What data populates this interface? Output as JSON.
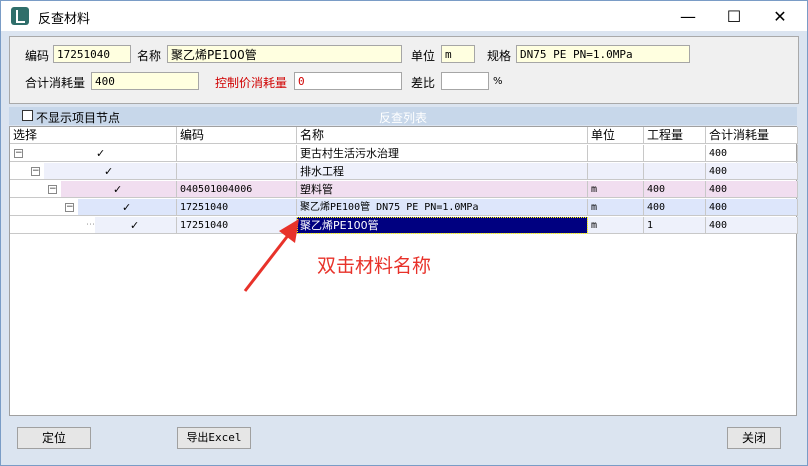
{
  "window": {
    "title": "反查材料"
  },
  "form": {
    "code_label": "编码",
    "code_value": "17251040",
    "name_label": "名称",
    "name_value": "聚乙烯PE100管",
    "unit_label": "单位",
    "unit_value": "m",
    "spec_label": "规格",
    "spec_value": "DN75 PE PN=1.0MPa",
    "total_label": "合计消耗量",
    "total_value": "400",
    "control_label": "控制价消耗量",
    "control_value": "0",
    "diff_label": "差比",
    "diff_value": "",
    "percent": "%"
  },
  "list": {
    "caption": "反查列表",
    "hide_nodes_label": "不显示项目节点",
    "headers": {
      "select": "选择",
      "code": "编码",
      "name": "名称",
      "unit": "单位",
      "qty": "工程量",
      "total": "合计消耗量"
    },
    "rows": [
      {
        "code": "",
        "name": "更古村生活污水治理",
        "unit": "",
        "qty": "",
        "total": "400"
      },
      {
        "code": "",
        "name": "排水工程",
        "unit": "",
        "qty": "",
        "total": "400"
      },
      {
        "code": "040501004006",
        "name": "塑料管",
        "unit": "m",
        "qty": "400",
        "total": "400"
      },
      {
        "code": "17251040",
        "name": "聚乙烯PE100管 DN75 PE PN=1.0MPa",
        "unit": "m",
        "qty": "400",
        "total": "400"
      },
      {
        "code": "17251040",
        "name": "聚乙烯PE100管",
        "unit": "m",
        "qty": "1",
        "total": "400"
      }
    ]
  },
  "buttons": {
    "locate": "定位",
    "export": "导出Excel",
    "close": "关闭"
  },
  "annotation": "双击材料名称",
  "colors": {
    "level2": "#eef0fb",
    "level3": "#f1def0",
    "level4": "#dde6fb",
    "level5": "#eef1fb",
    "selected": "#000080",
    "annotation": "#e8322a"
  }
}
